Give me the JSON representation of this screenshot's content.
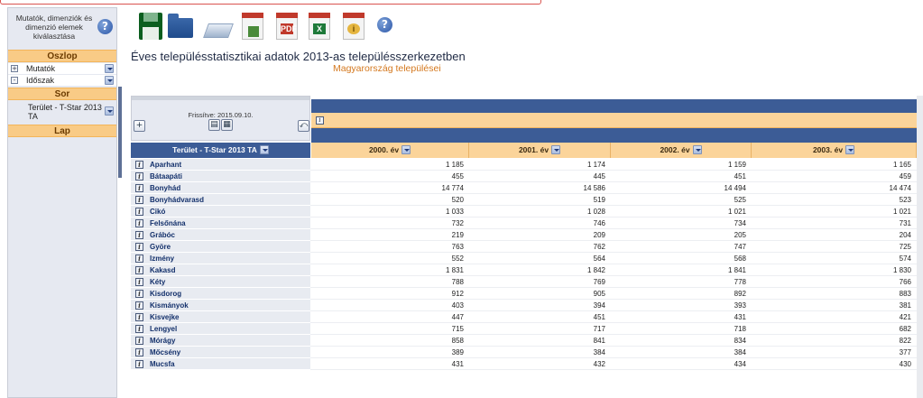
{
  "sidebar": {
    "header_text": "Mutatók, dimenziók és dimenzió elemek kiválasztása",
    "help_icon": "question-circle-icon",
    "sections": {
      "oszlop": "Oszlop",
      "sor": "Sor",
      "lap": "Lap"
    },
    "column_items": [
      {
        "label": "Mutatók",
        "state": "+"
      },
      {
        "label": "Időszak",
        "state": "-"
      }
    ],
    "row_item": "Terület - T-Star 2013 TA"
  },
  "toolbar": {
    "icons": [
      "save-icon",
      "open-folder-icon",
      "layers-icon",
      "chart-report-icon",
      "pdf-export-icon",
      "excel-export-icon",
      "info-doc-icon",
      "help-icon"
    ],
    "pdf_mark": "PDF",
    "excel_mark": "X",
    "info_mark": "i",
    "help_mark": "?"
  },
  "title": "Éves településstatisztikai adatok 2013-as településszerkezetben",
  "subtitle": "Magyarország települései",
  "table": {
    "updated": "Frissítve: 2015.09.10.",
    "row_dimension": "Terület - T-Star 2013 TA",
    "columns": [
      "2000. év",
      "2001. év",
      "2002. év",
      "2003. év"
    ],
    "rows": [
      {
        "name": "Aparhant",
        "values": [
          "1 185",
          "1 174",
          "1 159",
          "1 165"
        ]
      },
      {
        "name": "Bátaapáti",
        "values": [
          "455",
          "445",
          "451",
          "459"
        ]
      },
      {
        "name": "Bonyhád",
        "values": [
          "14 774",
          "14 586",
          "14 494",
          "14 474"
        ]
      },
      {
        "name": "Bonyhádvarasd",
        "values": [
          "520",
          "519",
          "525",
          "523"
        ]
      },
      {
        "name": "Cikó",
        "values": [
          "1 033",
          "1 028",
          "1 021",
          "1 021"
        ]
      },
      {
        "name": "Felsőnána",
        "values": [
          "732",
          "746",
          "734",
          "731"
        ]
      },
      {
        "name": "Grábóc",
        "values": [
          "219",
          "209",
          "205",
          "204"
        ]
      },
      {
        "name": "Györe",
        "values": [
          "763",
          "762",
          "747",
          "725"
        ]
      },
      {
        "name": "Izmény",
        "values": [
          "552",
          "564",
          "568",
          "574"
        ]
      },
      {
        "name": "Kakasd",
        "values": [
          "1 831",
          "1 842",
          "1 841",
          "1 830"
        ]
      },
      {
        "name": "Kéty",
        "values": [
          "788",
          "769",
          "778",
          "766"
        ]
      },
      {
        "name": "Kisdorog",
        "values": [
          "912",
          "905",
          "892",
          "883"
        ]
      },
      {
        "name": "Kismányok",
        "values": [
          "403",
          "394",
          "393",
          "381"
        ]
      },
      {
        "name": "Kisvejke",
        "values": [
          "447",
          "451",
          "431",
          "421"
        ]
      },
      {
        "name": "Lengyel",
        "values": [
          "715",
          "717",
          "718",
          "682"
        ]
      },
      {
        "name": "Mórágy",
        "values": [
          "858",
          "841",
          "834",
          "822"
        ]
      },
      {
        "name": "Mőcsény",
        "values": [
          "389",
          "384",
          "384",
          "377"
        ]
      },
      {
        "name": "Mucsfa",
        "values": [
          "431",
          "432",
          "434",
          "430"
        ]
      }
    ]
  },
  "colors": {
    "header_blue": "#3c5c96",
    "header_orange": "#fbd49a",
    "subtitle_orange": "#d4781e",
    "sidebar_bg": "#e6e9f1"
  }
}
